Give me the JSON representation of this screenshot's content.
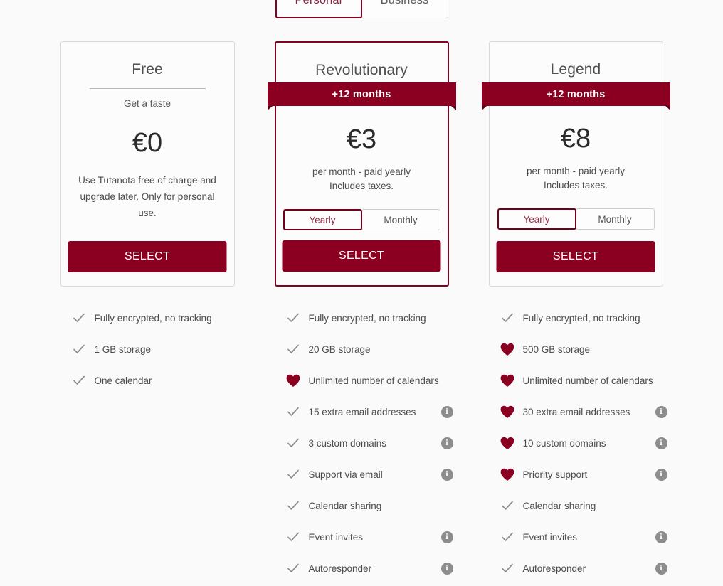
{
  "tabs": [
    {
      "label": "Personal",
      "active": true
    },
    {
      "label": "Business",
      "active": false
    }
  ],
  "colors": {
    "brand_red": "#8b0020",
    "border_red": "#850122",
    "toggle_text_red": "#8f2941",
    "icon_gray": "#8d8d8d",
    "page_bg": "#fafafa"
  },
  "plans": [
    {
      "name": "Free",
      "subtitle": "Get a taste",
      "price": "€0",
      "description": "Use Tutanota free of charge and upgrade later. Only for personal use.",
      "select_label": "SELECT",
      "featured": false,
      "has_ribbon": false,
      "ribbon": "",
      "billing_line1": "",
      "billing_line2": "",
      "has_toggle": false,
      "toggle": {
        "yearly": "Yearly",
        "monthly": "Monthly",
        "selected": "Yearly"
      }
    },
    {
      "name": "Revolutionary",
      "subtitle": "",
      "price": "€3",
      "description": "",
      "select_label": "SELECT",
      "featured": true,
      "has_ribbon": true,
      "ribbon": "+12 months",
      "billing_line1": "per month - paid yearly",
      "billing_line2": "Includes taxes.",
      "has_toggle": true,
      "toggle": {
        "yearly": "Yearly",
        "monthly": "Monthly",
        "selected": "Yearly"
      }
    },
    {
      "name": "Legend",
      "subtitle": "",
      "price": "€8",
      "description": "",
      "select_label": "SELECT",
      "featured": false,
      "has_ribbon": true,
      "ribbon": "+12 months",
      "billing_line1": "per month - paid yearly",
      "billing_line2": "Includes taxes.",
      "has_toggle": true,
      "toggle": {
        "yearly": "Yearly",
        "monthly": "Monthly",
        "selected": "Yearly"
      }
    }
  ],
  "feature_columns": [
    {
      "plan": "Free",
      "items": [
        {
          "label": "Fully encrypted, no tracking",
          "icon": "check-icon",
          "info": false
        },
        {
          "label": "1 GB storage",
          "icon": "check-icon",
          "info": false
        },
        {
          "label": "One calendar",
          "icon": "check-icon",
          "info": false
        }
      ]
    },
    {
      "plan": "Revolutionary",
      "items": [
        {
          "label": "Fully encrypted, no tracking",
          "icon": "check-icon",
          "info": false
        },
        {
          "label": "20 GB storage",
          "icon": "check-icon",
          "info": false
        },
        {
          "label": "Unlimited number of calendars",
          "icon": "heart-icon",
          "info": false
        },
        {
          "label": "15 extra email addresses",
          "icon": "check-icon",
          "info": true
        },
        {
          "label": "3 custom domains",
          "icon": "check-icon",
          "info": true
        },
        {
          "label": "Support via email",
          "icon": "check-icon",
          "info": true
        },
        {
          "label": "Calendar sharing",
          "icon": "check-icon",
          "info": false
        },
        {
          "label": "Event invites",
          "icon": "check-icon",
          "info": true
        },
        {
          "label": "Autoresponder",
          "icon": "check-icon",
          "info": true
        }
      ]
    },
    {
      "plan": "Legend",
      "items": [
        {
          "label": "Fully encrypted, no tracking",
          "icon": "check-icon",
          "info": false
        },
        {
          "label": "500 GB storage",
          "icon": "heart-icon",
          "info": false
        },
        {
          "label": "Unlimited number of calendars",
          "icon": "heart-icon",
          "info": false
        },
        {
          "label": "30 extra email addresses",
          "icon": "heart-icon",
          "info": true
        },
        {
          "label": "10 custom domains",
          "icon": "heart-icon",
          "info": true
        },
        {
          "label": "Priority support",
          "icon": "heart-icon",
          "info": true
        },
        {
          "label": "Calendar sharing",
          "icon": "check-icon",
          "info": false
        },
        {
          "label": "Event invites",
          "icon": "check-icon",
          "info": true
        },
        {
          "label": "Autoresponder",
          "icon": "check-icon",
          "info": true
        }
      ]
    }
  ],
  "info_icon_glyph": "i"
}
